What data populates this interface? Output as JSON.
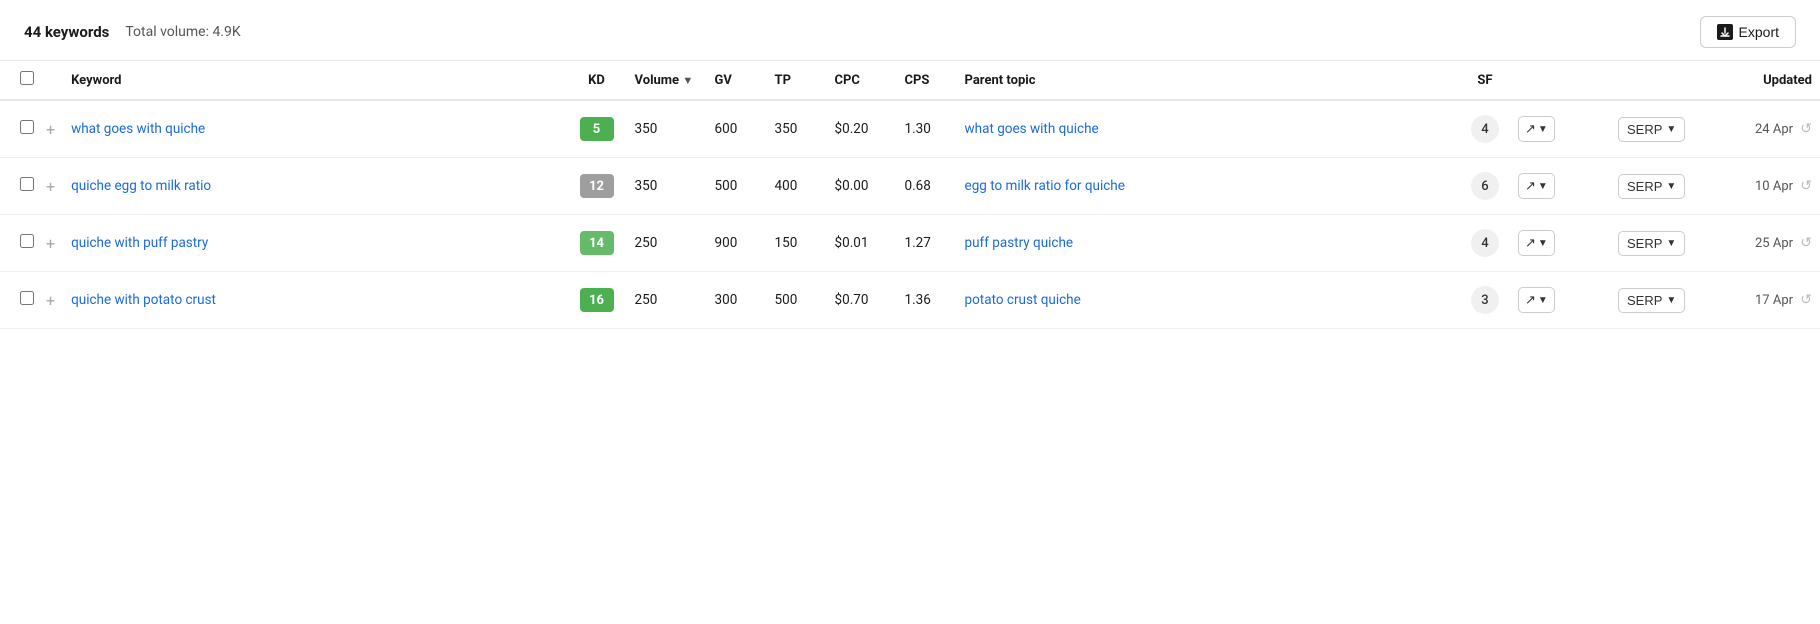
{
  "header": {
    "keywords_count": "44 keywords",
    "total_volume": "Total volume: 4.9K",
    "export_label": "Export"
  },
  "table": {
    "columns": {
      "keyword": "Keyword",
      "kd": "KD",
      "volume": "Volume",
      "gv": "GV",
      "tp": "TP",
      "cpc": "CPC",
      "cps": "CPS",
      "parent_topic": "Parent topic",
      "sf": "SF",
      "updated": "Updated"
    },
    "rows": [
      {
        "keyword": "what goes with quiche",
        "kd": "5",
        "kd_class": "kd-5",
        "volume": "350",
        "gv": "600",
        "tp": "350",
        "cpc": "$0.20",
        "cps": "1.30",
        "parent_topic": "what goes with quiche",
        "sf": "4",
        "updated": "24 Apr"
      },
      {
        "keyword": "quiche egg to milk ratio",
        "kd": "12",
        "kd_class": "kd-12",
        "volume": "350",
        "gv": "500",
        "tp": "400",
        "cpc": "$0.00",
        "cps": "0.68",
        "parent_topic": "egg to milk ratio for quiche",
        "sf": "6",
        "updated": "10 Apr"
      },
      {
        "keyword": "quiche with puff pastry",
        "kd": "14",
        "kd_class": "kd-14",
        "volume": "250",
        "gv": "900",
        "tp": "150",
        "cpc": "$0.01",
        "cps": "1.27",
        "parent_topic": "puff pastry quiche",
        "sf": "4",
        "updated": "25 Apr"
      },
      {
        "keyword": "quiche with potato crust",
        "kd": "16",
        "kd_class": "kd-16",
        "volume": "250",
        "gv": "300",
        "tp": "500",
        "cpc": "$0.70",
        "cps": "1.36",
        "parent_topic": "potato crust quiche",
        "sf": "3",
        "updated": "17 Apr"
      }
    ]
  }
}
